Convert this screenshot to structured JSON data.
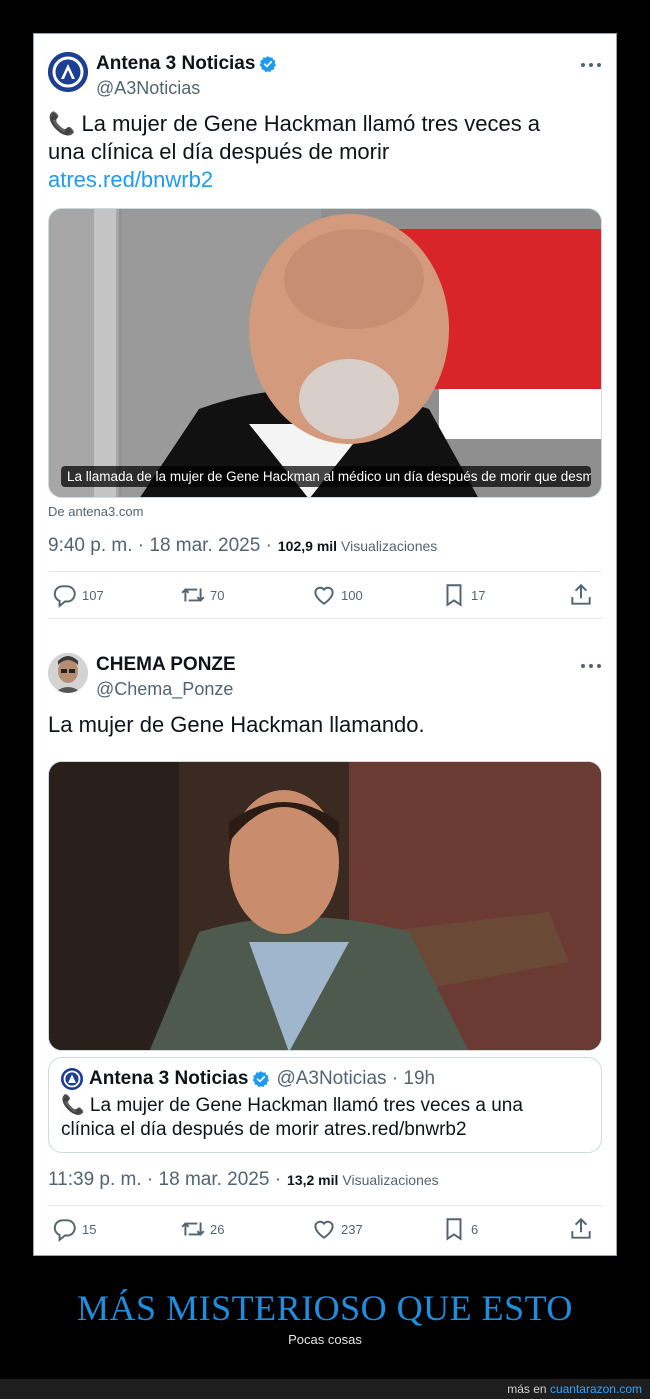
{
  "tweets": [
    {
      "display_name": "Antena 3 Noticias",
      "handle": "@A3Noticias",
      "text_line1": "📞 La mujer de Gene Hackman llamó tres veces a",
      "text_line2": "una clínica el día después de morir",
      "link": "atres.red/bnwrb2",
      "media_caption": "La llamada de la mujer de Gene Hackman al médico un día después de morir que desm...",
      "source": "De antena3.com",
      "timestamp": "9:40 p. m. · 18 mar. 2025 ·",
      "views": "102,9 mil",
      "views_label": "Visualizaciones",
      "replies": "107",
      "retweets": "70",
      "likes": "100",
      "bookmarks": "17"
    },
    {
      "display_name": "CHEMA PONZE",
      "handle": "@Chema_Ponze",
      "text": "La mujer de Gene Hackman llamando.",
      "quote": {
        "display_name": "Antena 3 Noticias",
        "handle": "@A3Noticias · 19h",
        "text_line1": "📞 La mujer de Gene Hackman llamó tres veces a una",
        "text_line2": "clínica el día después de morir atres.red/bnwrb2"
      },
      "timestamp": "11:39 p. m. · 18 mar. 2025 ·",
      "views": "13,2 mil",
      "views_label": "Visualizaciones",
      "replies": "15",
      "retweets": "26",
      "likes": "237",
      "bookmarks": "6"
    }
  ],
  "footer": {
    "title": "MÁS MISTERIOSO QUE ESTO",
    "subtitle": "Pocas cosas",
    "more_prefix": "más en",
    "site": "cuantarazon.com"
  },
  "colors": {
    "link": "#1d9bf0",
    "verified": "#1d9bf0",
    "footer_title": "#1d8fe0",
    "a3_brand": "#1c3f94"
  },
  "icons": [
    "verified-badge-icon",
    "more-icon",
    "reply-icon",
    "retweet-icon",
    "like-icon",
    "bookmark-icon",
    "share-icon",
    "antena3-logo"
  ]
}
